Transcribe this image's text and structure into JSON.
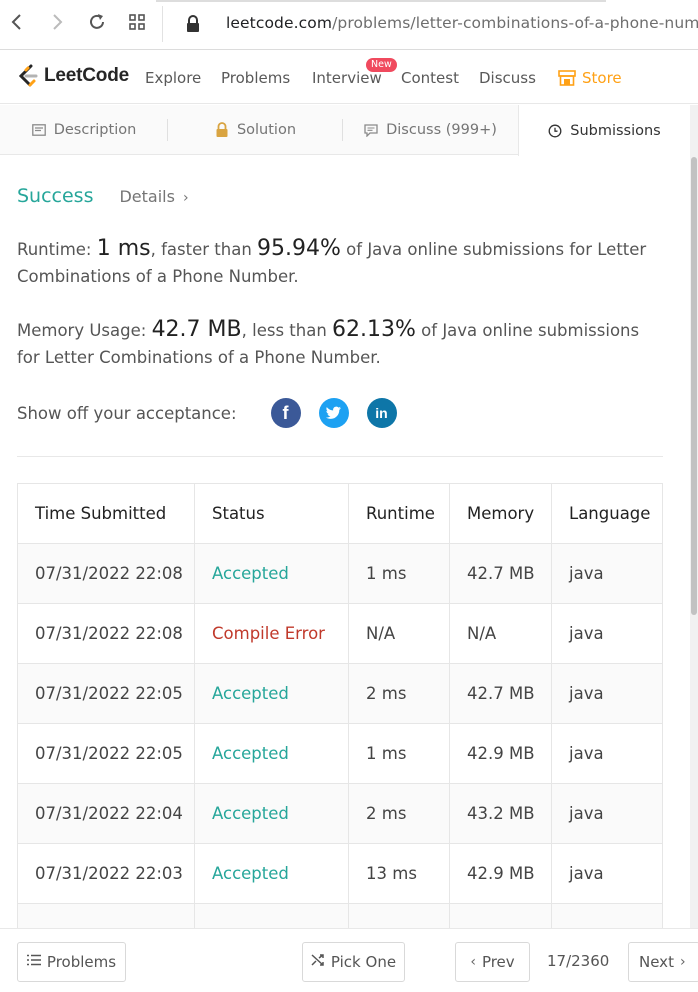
{
  "browser": {
    "url_host": "leetcode.com",
    "url_path": "/problems/letter-combinations-of-a-phone-number/"
  },
  "nav": {
    "logo_text": "LeetCode",
    "links": [
      "Explore",
      "Problems",
      "Interview",
      "Contest",
      "Discuss"
    ],
    "interview_badge": "New",
    "store_label": "Store"
  },
  "tabs": {
    "description": "Description",
    "solution": "Solution",
    "discuss": "Discuss (999+)",
    "submissions": "Submissions"
  },
  "result": {
    "status": "Success",
    "details_label": "Details",
    "runtime_label": "Runtime: ",
    "runtime_value": "1 ms",
    "runtime_mid": ", faster than ",
    "runtime_pct": "95.94%",
    "runtime_desc": " of Java online submissions for Letter Combinations of a Phone Number.",
    "memory_label": "Memory Usage: ",
    "memory_value": "42.7 MB",
    "memory_mid": ", less than ",
    "memory_pct": "62.13%",
    "memory_desc": " of Java online submissions for Letter Combinations of a Phone Number.",
    "share_label": "Show off your acceptance:"
  },
  "table": {
    "headers": [
      "Time Submitted",
      "Status",
      "Runtime",
      "Memory",
      "Language"
    ],
    "rows": [
      [
        "07/31/2022 22:08",
        "Accepted",
        "1 ms",
        "42.7 MB",
        "java"
      ],
      [
        "07/31/2022 22:08",
        "Compile Error",
        "N/A",
        "N/A",
        "java"
      ],
      [
        "07/31/2022 22:05",
        "Accepted",
        "2 ms",
        "42.7 MB",
        "java"
      ],
      [
        "07/31/2022 22:05",
        "Accepted",
        "1 ms",
        "42.9 MB",
        "java"
      ],
      [
        "07/31/2022 22:04",
        "Accepted",
        "2 ms",
        "43.2 MB",
        "java"
      ],
      [
        "07/31/2022 22:03",
        "Accepted",
        "13 ms",
        "42.9 MB",
        "java"
      ]
    ]
  },
  "footer": {
    "problems_label": "Problems",
    "pick_one_label": "Pick One",
    "prev_label": "Prev",
    "page_info": "17/2360",
    "next_label": "Next"
  },
  "colors": {
    "accent_green": "#26a69a",
    "error_red": "#c0392b",
    "store_orange": "#ffa116",
    "badge_red": "#f04a5e"
  }
}
